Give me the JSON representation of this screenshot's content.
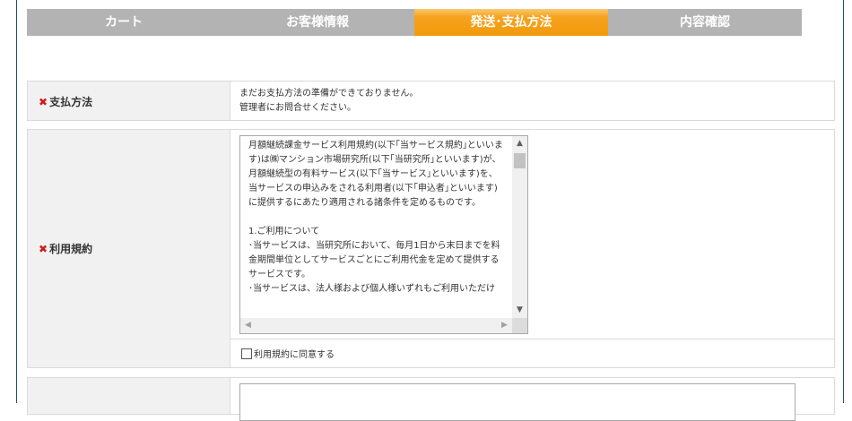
{
  "steps": [
    {
      "label": "カート"
    },
    {
      "label": "お客様情報"
    },
    {
      "label": "発送･支払方法"
    },
    {
      "label": "内容確認"
    }
  ],
  "payment": {
    "required_mark": "✖",
    "label": "支払方法",
    "message_line1": "まだお支払方法の準備ができておりません。",
    "message_line2": "管理者にお問合せください。"
  },
  "terms": {
    "required_mark": "✖",
    "label": "利用規約",
    "text": "月額継続課金サービス利用規約(以下｢当サービス規約｣といいます)は㈱マンション市場研究所(以下｢当研究所｣といいます)が、月額継続型の有料サービス(以下｢当サービス｣といいます)を、当サービスの申込みをされる利用者(以下｢申込者｣といいます)に提供するにあたり適用される諸条件を定めるものです。\n\n1.ご利用について\n･当サービスは、当研究所において、毎月1日から末日までを料金期間単位としてサービスごとにご利用代金を定めて提供するサービスです。\n･当サービスは、法人様および個人様いずれもご利用いただけ",
    "agree_label": "利用規約に同意する"
  },
  "colors": {
    "tab_inactive": "#b3b3b3",
    "tab_active": "#f29a0c",
    "required": "#d11a1a",
    "header_cell": "#f1f1f1"
  }
}
